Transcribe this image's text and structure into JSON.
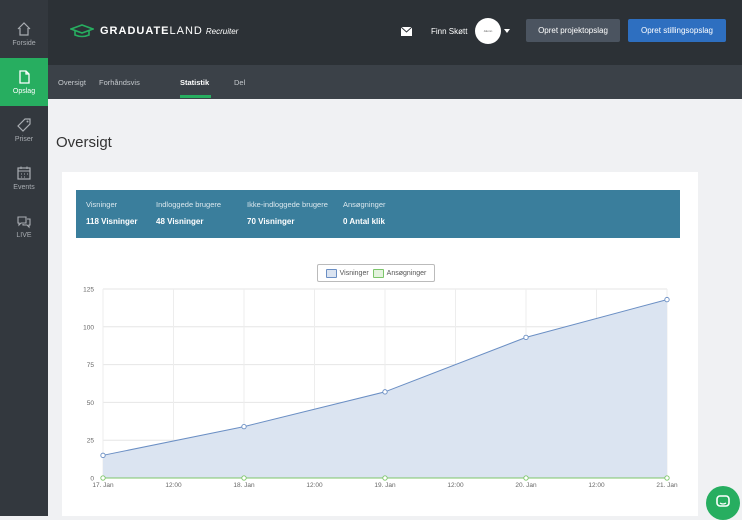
{
  "sidebar": {
    "items": [
      {
        "label": "Forside",
        "icon": "home-icon"
      },
      {
        "label": "Opslag",
        "icon": "document-icon",
        "active": true
      },
      {
        "label": "Priser",
        "icon": "tag-icon"
      },
      {
        "label": "Events",
        "icon": "calendar-icon"
      },
      {
        "label": "LIVE",
        "icon": "chat-icon"
      }
    ]
  },
  "header": {
    "logo_bold": "GRADUATE",
    "logo_light": "LAND",
    "logo_sub": "Recruiter",
    "user_name": "Finn Skøtt",
    "avatar_text": "Alumn",
    "project_button": "Opret projektopslag",
    "job_button": "Opret stillingsopslag"
  },
  "tabs": [
    {
      "label": "Oversigt"
    },
    {
      "label": "Forhåndsvis"
    },
    {
      "label": "Statistik",
      "active": true
    },
    {
      "label": "Del"
    }
  ],
  "page_title": "Oversigt",
  "stats": [
    {
      "label": "Visninger",
      "value": "118 Visninger"
    },
    {
      "label": "Indloggede brugere",
      "value": "48 Visninger"
    },
    {
      "label": "Ikke-indloggede brugere",
      "value": "70 Visninger"
    },
    {
      "label": "Ansøgninger",
      "value": "0 Antal klik"
    }
  ],
  "colors": {
    "accent_green": "#27ae60",
    "stats_bar": "#3a7e9c",
    "button_blue": "#2e6fc0",
    "series_views": "#6b8fc4",
    "series_applications": "#7cc56a"
  },
  "chart_data": {
    "type": "area",
    "x": [
      "17. Jan",
      "18. Jan",
      "19. Jan",
      "20. Jan",
      "21. Jan"
    ],
    "x_ticks": [
      "17. Jan",
      "12:00",
      "18. Jan",
      "12:00",
      "19. Jan",
      "12:00",
      "20. Jan",
      "12:00",
      "21. Jan"
    ],
    "series": [
      {
        "name": "Visninger",
        "values": [
          15,
          34,
          57,
          93,
          118
        ]
      },
      {
        "name": "Ansøgninger",
        "values": [
          0,
          0,
          0,
          0,
          0
        ]
      }
    ],
    "ylim": [
      0,
      125
    ],
    "yticks": [
      0,
      25,
      50,
      75,
      100,
      125
    ],
    "grid": true,
    "legend": "top-center"
  }
}
